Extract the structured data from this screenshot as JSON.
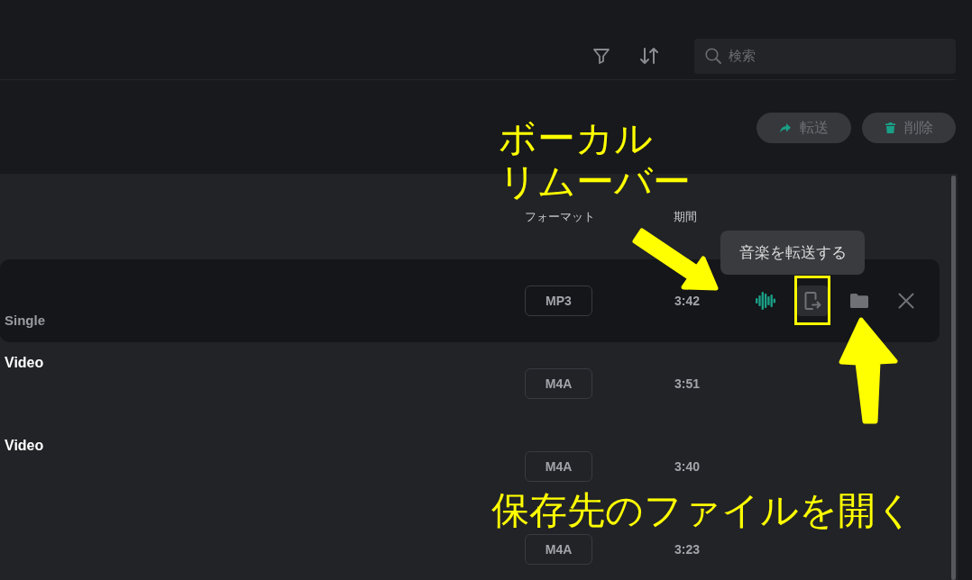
{
  "toolbar": {
    "search": {
      "placeholder": "検索"
    }
  },
  "actions": [
    {
      "kind": "transfer",
      "label": "転送",
      "disabled": true
    },
    {
      "kind": "delete",
      "label": "削除",
      "disabled": true
    }
  ],
  "list": {
    "columns": [
      "フォーマット",
      "期間"
    ],
    "rows": [
      {
        "subtitle": "Single",
        "format": "MP3",
        "duration": "3:42",
        "selected": true,
        "actions": [
          {
            "kind": "vocal-remover",
            "hovered": false
          },
          {
            "kind": "transfer",
            "hovered": true,
            "tooltip": "音楽を転送する"
          },
          {
            "kind": "open-folder",
            "hovered": false
          },
          {
            "kind": "remove",
            "hovered": false
          }
        ]
      },
      {
        "title": "Video",
        "format": "M4A",
        "duration": "3:51",
        "selected": false
      },
      {
        "title": "Video",
        "format": "M4A",
        "duration": "3:40",
        "selected": false
      },
      {
        "format": "M4A",
        "duration": "3:23",
        "selected": false
      }
    ]
  },
  "annotations": [
    {
      "lines": [
        "ボーカル",
        "リムーバー"
      ]
    },
    {
      "lines": [
        "保存先のファイルを開く"
      ]
    }
  ]
}
